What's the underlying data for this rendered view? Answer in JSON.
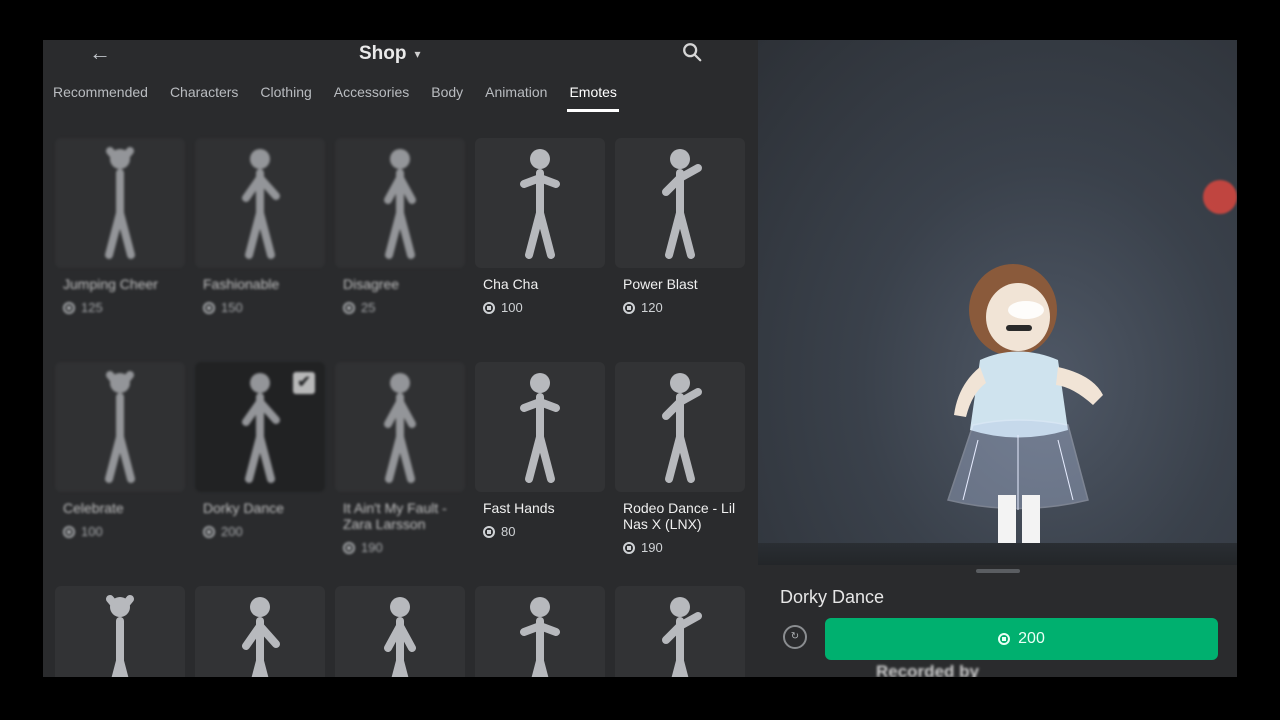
{
  "header": {
    "back_icon": "back-arrow-icon",
    "title": "Shop",
    "search_icon": "search-icon"
  },
  "tabs": [
    {
      "label": "Recommended",
      "active": false
    },
    {
      "label": "Characters",
      "active": false
    },
    {
      "label": "Clothing",
      "active": false
    },
    {
      "label": "Accessories",
      "active": false
    },
    {
      "label": "Body",
      "active": false
    },
    {
      "label": "Animation",
      "active": false
    },
    {
      "label": "Emotes",
      "active": true
    }
  ],
  "items": [
    {
      "name": "Jumping Cheer",
      "price": "125"
    },
    {
      "name": "Fashionable",
      "price": "150"
    },
    {
      "name": "Disagree",
      "price": "25"
    },
    {
      "name": "Cha Cha",
      "price": "100"
    },
    {
      "name": "Power Blast",
      "price": "120"
    },
    {
      "name": "Celebrate",
      "price": "100"
    },
    {
      "name": "Dorky Dance",
      "price": "200",
      "selected": true
    },
    {
      "name": "It Ain't My Fault - Zara Larsson",
      "price": "190"
    },
    {
      "name": "Fast Hands",
      "price": "80"
    },
    {
      "name": "Rodeo Dance - Lil Nas X (LNX)",
      "price": "190"
    },
    {
      "name": "",
      "price": ""
    },
    {
      "name": "",
      "price": ""
    },
    {
      "name": "",
      "price": ""
    },
    {
      "name": "",
      "price": ""
    },
    {
      "name": "",
      "price": ""
    }
  ],
  "preview": {
    "selected_item_title": "Dorky Dance",
    "buy_price": "200",
    "watermark": "Recorded by"
  },
  "colors": {
    "background": "#2a2b2d",
    "buy_button": "#00b06f",
    "text": "#e6e6e6"
  }
}
